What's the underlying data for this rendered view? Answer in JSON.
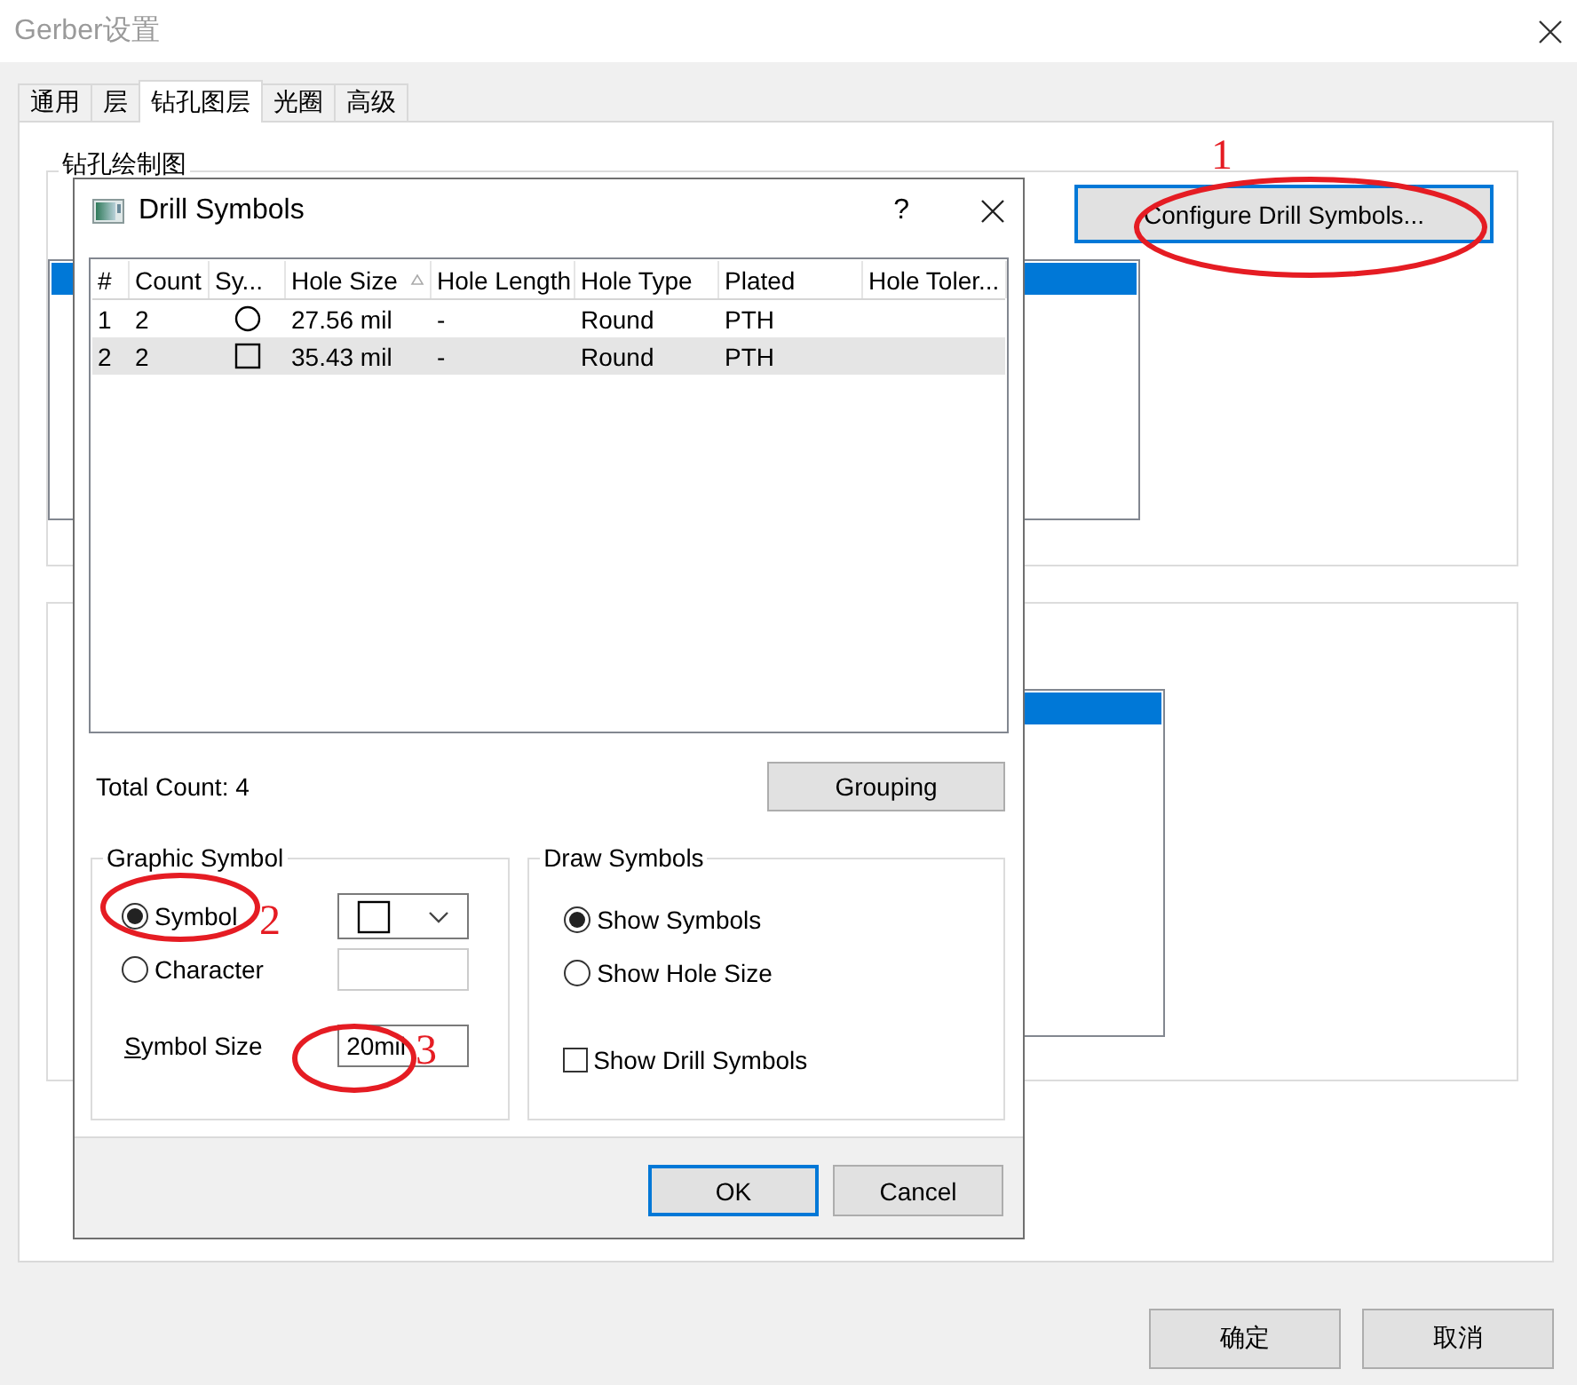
{
  "window": {
    "title": "Gerber设置"
  },
  "tabs": [
    {
      "label": "通用",
      "selected": false
    },
    {
      "label": "层",
      "selected": false
    },
    {
      "label": "钻孔图层",
      "selected": true
    },
    {
      "label": "光圈",
      "selected": false
    },
    {
      "label": "高级",
      "selected": false
    }
  ],
  "drill_drawing_group": {
    "label": "钻孔绘制图",
    "configure_button": "Configure Drill Symbols...",
    "focused": true
  },
  "dialog": {
    "title": "Drill Symbols",
    "help": "?",
    "columns": [
      {
        "label": "#",
        "sorted": false
      },
      {
        "label": "Count",
        "sorted": false
      },
      {
        "label": "Sy...",
        "sorted": false
      },
      {
        "label": "Hole Size",
        "sorted": true
      },
      {
        "label": "Hole Length",
        "sorted": false
      },
      {
        "label": "Hole Type",
        "sorted": false
      },
      {
        "label": "Plated",
        "sorted": false
      },
      {
        "label": "Hole Toler...",
        "sorted": false
      }
    ],
    "rows": [
      {
        "index": "1",
        "count": "2",
        "symbol": {
          "kind": "circle"
        },
        "hole_size": "27.56 mil",
        "hole_length": "-",
        "hole_type": "Round",
        "plated": "PTH",
        "selected": false
      },
      {
        "index": "2",
        "count": "2",
        "symbol": {
          "kind": "square"
        },
        "hole_size": "35.43 mil",
        "hole_length": "-",
        "hole_type": "Round",
        "plated": "PTH",
        "selected": true
      }
    ],
    "total_count": "Total Count: 4",
    "grouping_button": "Grouping",
    "graphic_symbol": {
      "label": "Graphic Symbol",
      "options": [
        {
          "kind": "dropdown",
          "label": "Symbol",
          "selected": true,
          "symbol": {
            "kind": "square"
          }
        },
        {
          "kind": "field",
          "label": "Character",
          "selected": false
        }
      ],
      "size_label": "Symbol Size",
      "size_value": "20mil"
    },
    "draw_symbols": {
      "label": "Draw Symbols",
      "options": [
        {
          "label": "Show Symbols",
          "selected": true
        },
        {
          "label": "Show Hole Size",
          "selected": false
        }
      ],
      "checkbox": {
        "label": "Show Drill Symbols",
        "checked": false
      }
    },
    "buttons": [
      {
        "label": "OK",
        "default": true
      },
      {
        "label": "Cancel",
        "default": false
      }
    ]
  },
  "footer_buttons": [
    "确定",
    "取消"
  ],
  "annotations": [
    {
      "number": "1"
    },
    {
      "number": "2"
    },
    {
      "number": "3"
    }
  ]
}
